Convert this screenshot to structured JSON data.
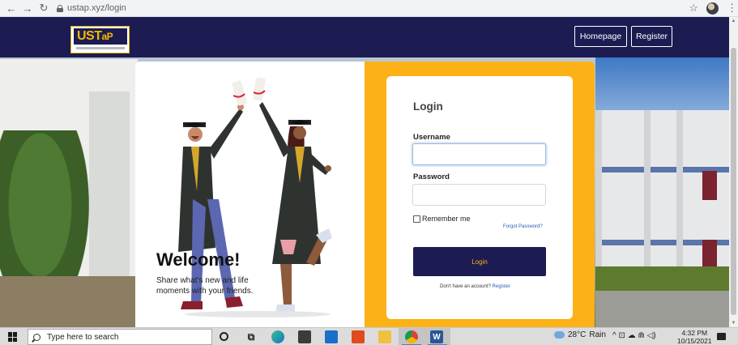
{
  "browser": {
    "url": "ustap.xyz/login",
    "back_icon": "←",
    "forward_icon": "→",
    "reload_icon": "↻",
    "star_icon": "☆",
    "menu_icon": "⋮"
  },
  "header": {
    "logo_text": "UST",
    "logo_accent": "aP",
    "nav": {
      "homepage": "Homepage",
      "register": "Register"
    }
  },
  "hero": {
    "welcome": "Welcome!",
    "tagline": "Share what's new and life moments with your friends."
  },
  "login": {
    "title": "Login",
    "username_label": "Username",
    "username_value": "",
    "password_label": "Password",
    "password_value": "",
    "remember_label": "Remember me",
    "forgot_label": "Forgot Password?",
    "submit_label": "Login",
    "no_account_text": "Don't have an account?",
    "register_link": "Register"
  },
  "taskbar": {
    "search_placeholder": "Type here to search",
    "weather_temp": "28°C",
    "weather_text": "Rain",
    "time": "4:32 PM",
    "date": "10/15/2021",
    "taskview_icon": "⧉",
    "tray_icons": "^ ⊡ ☁ ⋒ ◁)"
  },
  "colors": {
    "navy": "#1c1c53",
    "accent": "#fcb217",
    "link": "#2a5db0"
  }
}
